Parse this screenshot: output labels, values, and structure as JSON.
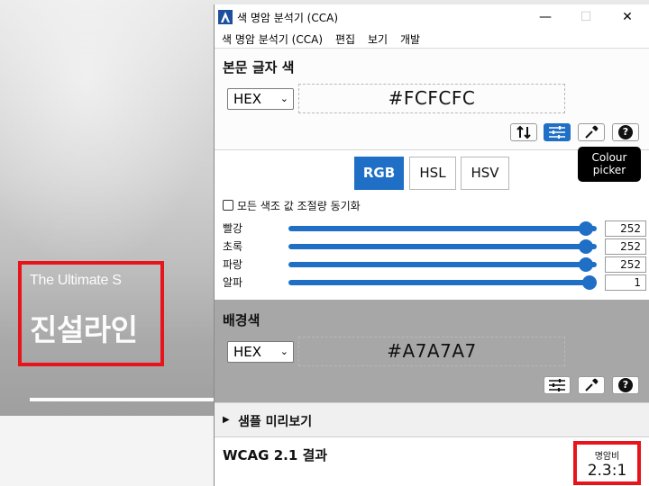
{
  "background_page": {
    "subtitle": "The Ultimate S",
    "title": "진설라인"
  },
  "window": {
    "title": "색 명암 분석기 (CCA)",
    "controls": {
      "minimize": "—",
      "maximize": "☐",
      "close": "✕"
    }
  },
  "menu": [
    "색 명암 분석기 (CCA)",
    "편집",
    "보기",
    "개발"
  ],
  "foreground": {
    "title": "본문 글자 색",
    "format": "HEX",
    "hex": "#FCFCFC",
    "tooltip": "Colour picker"
  },
  "color_model_tabs": [
    {
      "label": "RGB",
      "active": true
    },
    {
      "label": "HSL",
      "active": false
    },
    {
      "label": "HSV",
      "active": false
    }
  ],
  "sync_checkbox": {
    "label": "모든 색조 값 조절량 동기화",
    "checked": false
  },
  "channels": [
    {
      "label": "빨강",
      "value": "252",
      "fraction": 0.988
    },
    {
      "label": "초록",
      "value": "252",
      "fraction": 0.988
    },
    {
      "label": "파랑",
      "value": "252",
      "fraction": 0.988
    },
    {
      "label": "알파",
      "value": "1",
      "fraction": 1.0
    }
  ],
  "background": {
    "title": "배경색",
    "format": "HEX",
    "hex": "#A7A7A7"
  },
  "preview": {
    "label": "샘플 미리보기"
  },
  "wcag": {
    "label": "WCAG 2.1 결과",
    "ratio_label": "명암비",
    "ratio_value": "2.3:1"
  },
  "colors": {
    "accent": "#1f6fc7",
    "highlight_box": "#e8141b",
    "foreground": "#FCFCFC",
    "background": "#A7A7A7"
  },
  "icons": [
    "app-logo-icon",
    "swap-icon",
    "sliders-icon",
    "eyedropper-icon",
    "help-icon",
    "chevron-down-icon",
    "triangle-right-icon"
  ]
}
